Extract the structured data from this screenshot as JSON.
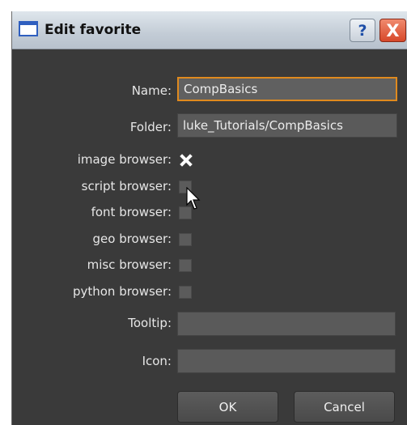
{
  "window": {
    "title": "Edit favorite"
  },
  "titlebar_buttons": {
    "help": "?",
    "close": "X"
  },
  "fields": {
    "name": {
      "label": "Name:",
      "value": "CompBasics"
    },
    "folder": {
      "label": "Folder:",
      "value": "luke_Tutorials/CompBasics"
    },
    "tooltip": {
      "label": "Tooltip:",
      "value": ""
    },
    "icon": {
      "label": "Icon:",
      "value": ""
    }
  },
  "checkboxes": [
    {
      "label": "image browser:",
      "checked": true
    },
    {
      "label": "script browser:",
      "checked": false
    },
    {
      "label": "font browser:",
      "checked": false
    },
    {
      "label": "geo browser:",
      "checked": false
    },
    {
      "label": "misc browser:",
      "checked": false
    },
    {
      "label": "python browser:",
      "checked": false
    }
  ],
  "buttons": {
    "ok": "OK",
    "cancel": "Cancel"
  },
  "colors": {
    "panel_bg": "#3a3a3a",
    "field_bg": "#5a5a5a",
    "focus_border": "#e08a1e",
    "text": "#e6e6e6"
  }
}
